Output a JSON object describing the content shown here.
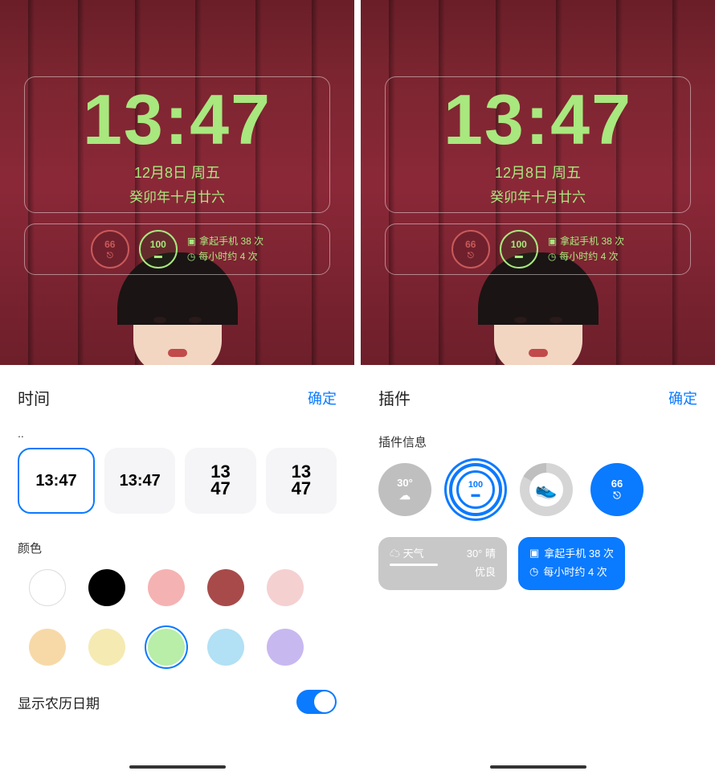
{
  "lockscreen": {
    "time": "13:47",
    "date": "12月8日  周五",
    "lunar": "癸卯年十月廿六",
    "widget_66": "66",
    "widget_100": "100",
    "pickup_line1": "拿起手机 38 次",
    "pickup_line2": "每小时约 4 次"
  },
  "left": {
    "title": "时间",
    "confirm": "确定",
    "truncated_label": "..",
    "styles": [
      "13:47",
      "13:47",
      "13\n47",
      "13\n47"
    ],
    "color_label": "颜色",
    "colors": [
      "#ffffff",
      "#000000",
      "#f5b2b2",
      "#a84a4a",
      "#f5d0d0",
      "#f7d9a8",
      "#f5eab2",
      "#b8eea8",
      "#b2e0f5",
      "#c8b8f0"
    ],
    "selected_color_index": 7,
    "lunar_label": "显示农历日期"
  },
  "right": {
    "title": "插件",
    "confirm": "确定",
    "section": "插件信息",
    "circle_30": "30°",
    "circle_100": "100",
    "circle_66": "66",
    "weather": {
      "label": "天气",
      "temp": "30° 晴",
      "quality": "优良"
    },
    "pickup": {
      "line1": "拿起手机 38 次",
      "line2": "每小时约 4 次"
    }
  }
}
